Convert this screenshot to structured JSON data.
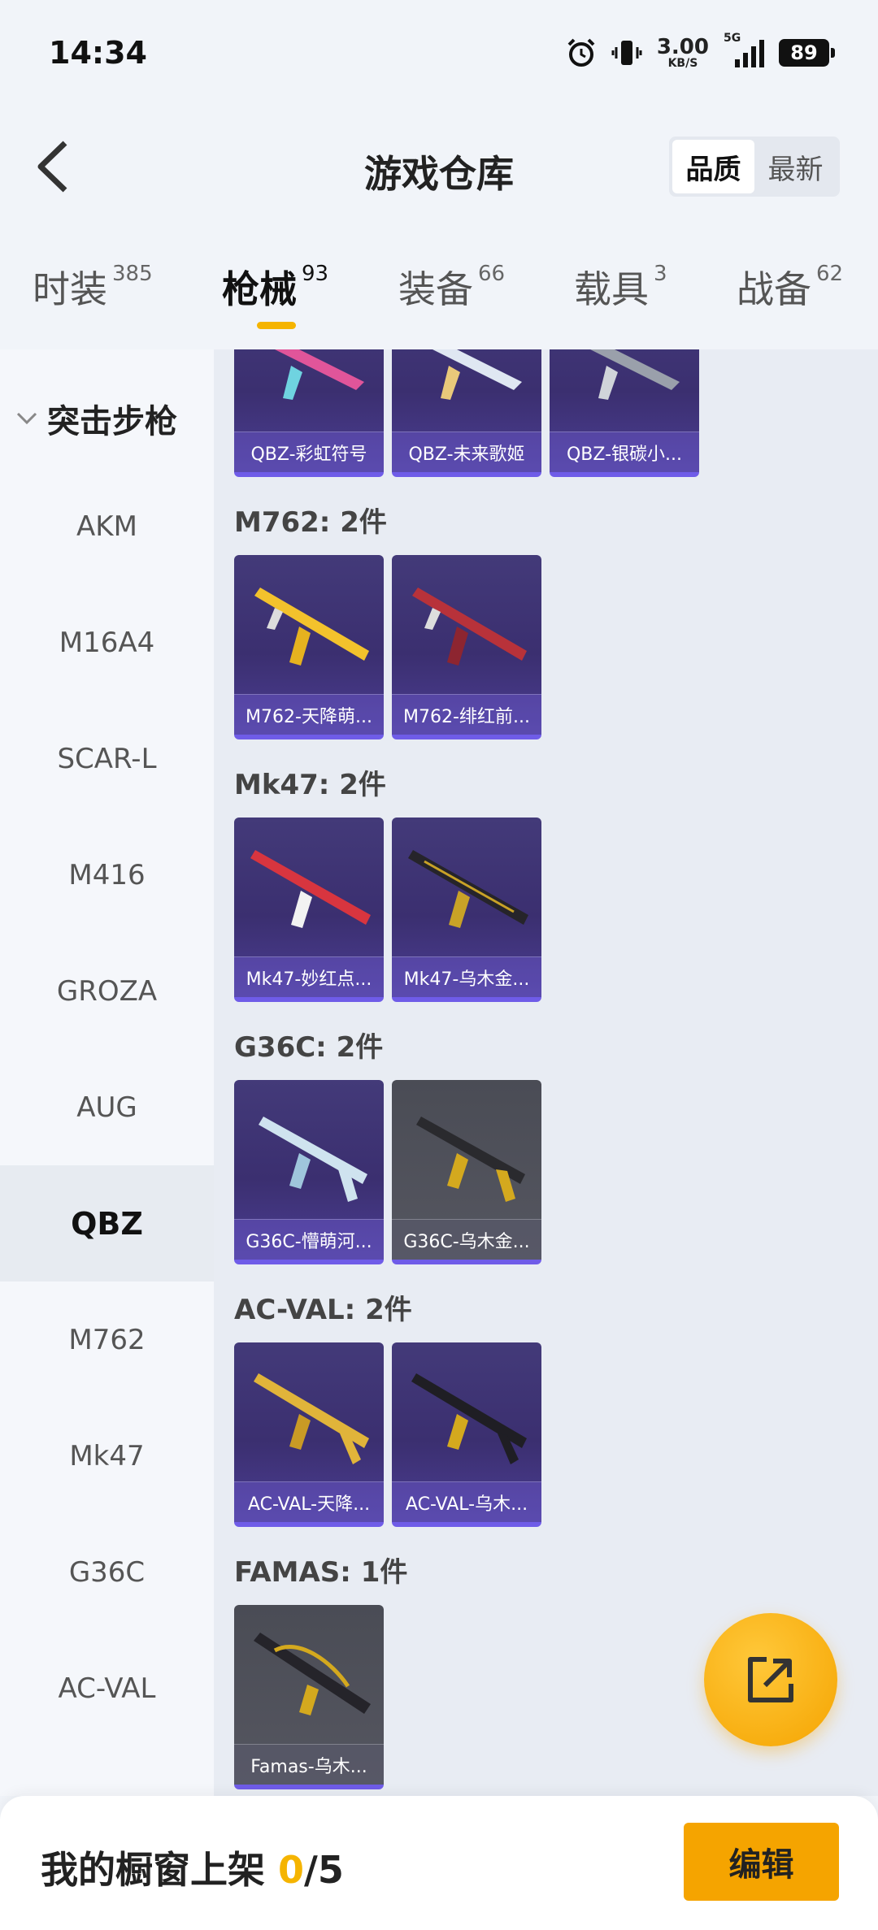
{
  "status_bar": {
    "time": "14:34",
    "net_speed_value": "3.00",
    "net_speed_unit": "KB/S",
    "network_type": "5G",
    "battery": "89"
  },
  "header": {
    "title": "游戏仓库",
    "sort_options": [
      "品质",
      "最新"
    ],
    "sort_selected": "品质"
  },
  "category_tabs": [
    {
      "label": "时装",
      "count": "385"
    },
    {
      "label": "枪械",
      "count": "93"
    },
    {
      "label": "装备",
      "count": "66"
    },
    {
      "label": "载具",
      "count": "3"
    },
    {
      "label": "战备",
      "count": "62"
    }
  ],
  "active_tab": "枪械",
  "sidebar": {
    "group_label": "突击步枪",
    "items": [
      "AKM",
      "M16A4",
      "SCAR-L",
      "M416",
      "GROZA",
      "AUG",
      "QBZ",
      "M762",
      "Mk47",
      "G36C",
      "AC-VAL"
    ],
    "active_item": "QBZ"
  },
  "content": {
    "partial_row": [
      "QBZ-彩虹符号",
      "QBZ-未来歌姬",
      "QBZ-银碳小..."
    ],
    "sections": [
      {
        "title": "M762: 2件",
        "items": [
          "M762-天降萌...",
          "M762-绯红前..."
        ]
      },
      {
        "title": "Mk47: 2件",
        "items": [
          "Mk47-妙红点...",
          "Mk47-乌木金..."
        ]
      },
      {
        "title": "G36C: 2件",
        "items": [
          "G36C-懵萌河...",
          "G36C-乌木金..."
        ]
      },
      {
        "title": "AC-VAL: 2件",
        "items": [
          "AC-VAL-天降...",
          "AC-VAL-乌木..."
        ]
      },
      {
        "title": "FAMAS: 1件",
        "items": [
          "Famas-乌木..."
        ]
      }
    ]
  },
  "bottom_bar": {
    "label": "我的橱窗上架",
    "current": "0",
    "total": "/5",
    "edit_label": "编辑"
  },
  "colors": {
    "accent": "#f5b400",
    "card_purple": "#3b2f70",
    "card_grey": "#4a4c55"
  },
  "icons": [
    "alarm-icon",
    "vibrate-icon",
    "signal-icon",
    "battery-icon",
    "back-arrow-icon",
    "chevron-down-icon",
    "share-export-icon"
  ]
}
